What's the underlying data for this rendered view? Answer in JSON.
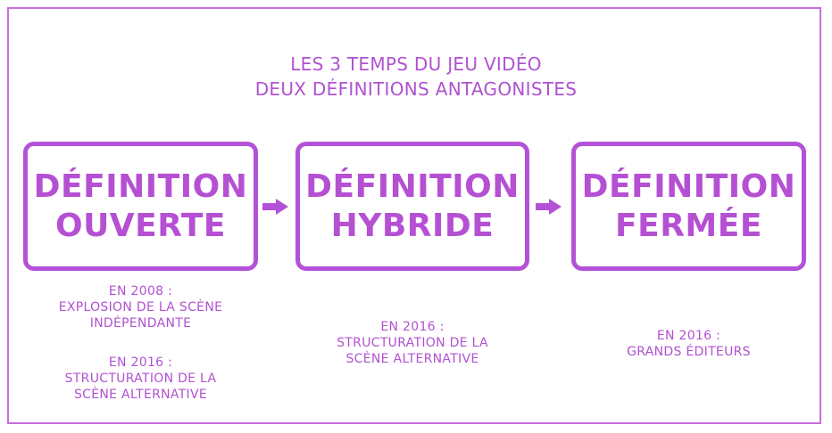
{
  "title": {
    "line1": "LES 3 TEMPS DU JEU VIDÉO",
    "line2": "DEUX DÉFINITIONS ANTAGONISTES"
  },
  "boxes": [
    {
      "line1": "DÉFINITION",
      "line2": "OUVERTE"
    },
    {
      "line1": "DÉFINITION",
      "line2": "HYBRIDE"
    },
    {
      "line1": "DÉFINITION",
      "line2": "FERMÉE"
    }
  ],
  "descriptions": {
    "col1": {
      "block1": [
        "EN 2008 :",
        "EXPLOSION DE LA SCÈNE",
        "INDÉPENDANTE"
      ],
      "block2": [
        "EN 2016 :",
        "STRUCTURATION DE LA",
        "SCÈNE ALTERNATIVE"
      ]
    },
    "col2": [
      "EN 2016 :",
      "STRUCTURATION DE LA",
      "SCÈNE ALTERNATIVE"
    ],
    "col3": [
      "EN 2016 :",
      "GRANDS ÉDITEURS"
    ]
  },
  "colors": {
    "accent": "#b352d8",
    "frame": "#c76ee0"
  },
  "icons": [
    "arrow-right-icon",
    "arrow-right-icon"
  ]
}
